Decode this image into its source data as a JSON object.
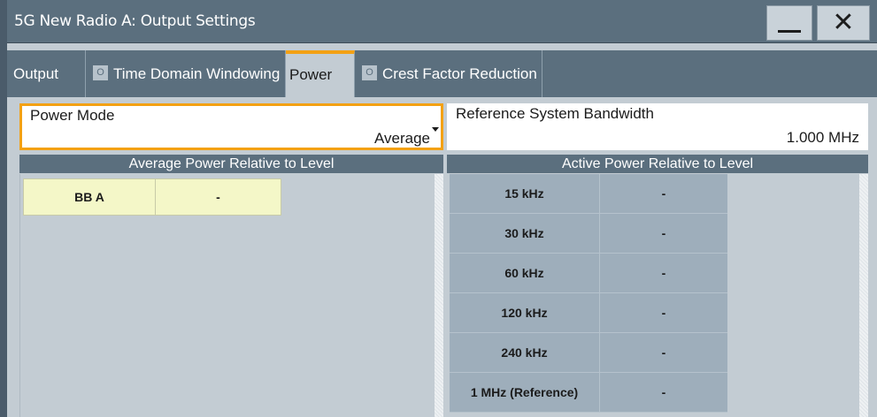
{
  "window": {
    "title": "5G New Radio A: Output Settings"
  },
  "title_buttons": {
    "minimize_icon": "minimize-icon",
    "close_glyph": "✕"
  },
  "tabs": [
    {
      "label": "Output",
      "checkbox": ""
    },
    {
      "label": "Time Domain Windowing",
      "checkbox": "O"
    },
    {
      "label": "Power",
      "checkbox": ""
    },
    {
      "label": "Crest Factor Reduction",
      "checkbox": "O"
    }
  ],
  "power_mode": {
    "label": "Power Mode",
    "value": "Average"
  },
  "reference_bandwidth": {
    "label": "Reference System Bandwidth",
    "value": "1.000 MHz"
  },
  "average_power": {
    "header": "Average Power Relative to Level",
    "rows": [
      {
        "name": "BB A",
        "value": "-"
      }
    ]
  },
  "active_power": {
    "header": "Active Power Relative to Level",
    "rows": [
      {
        "name": "15 kHz",
        "value": "-"
      },
      {
        "name": "30 kHz",
        "value": "-"
      },
      {
        "name": "60 kHz",
        "value": "-"
      },
      {
        "name": "120 kHz",
        "value": "-"
      },
      {
        "name": "240 kHz",
        "value": "-"
      },
      {
        "name": "1  MHz (Reference)",
        "value": "-"
      }
    ]
  },
  "colors": {
    "accent": "#f3a114",
    "titlebar": "#5b6f7e",
    "highlight_row": "#f4f7c8"
  }
}
